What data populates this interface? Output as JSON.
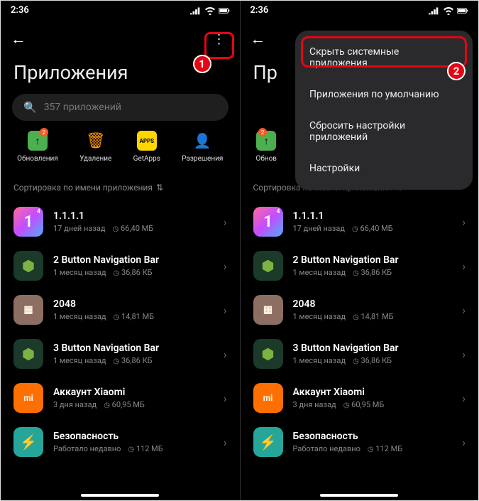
{
  "status": {
    "time": "2:36"
  },
  "header": {
    "title": "Приложения",
    "title_cut": "Пр"
  },
  "search": {
    "placeholder": "357 приложений"
  },
  "actions": {
    "updates": {
      "label": "Обновления",
      "badge": "2"
    },
    "delete": {
      "label": "Удаление"
    },
    "getapps": {
      "label": "GetApps",
      "icon_text": "APPS"
    },
    "permissions": {
      "label": "Разрешения"
    },
    "updates_cut": {
      "label": "Обнов"
    }
  },
  "sort": {
    "label": "Сортировка по имени приложения"
  },
  "menu": {
    "hide_system": "Скрыть системные приложения",
    "default_apps": "Приложения по умолчанию",
    "reset_prefs": "Сбросить настройки приложений",
    "settings": "Настройки"
  },
  "callouts": {
    "one": "1",
    "two": "2"
  },
  "apps": [
    {
      "name": "1.1.1.1",
      "time": "17 дней назад",
      "size": "66,40 МБ",
      "icon": "1111",
      "sup": "4"
    },
    {
      "name": "2 Button Navigation Bar",
      "time": "1 месяц назад",
      "size": "36,86 КБ",
      "icon": "droid"
    },
    {
      "name": "2048",
      "time": "1 месяц назад",
      "size": "14,81 МБ",
      "icon": "2048"
    },
    {
      "name": "3 Button Navigation Bar",
      "time": "1 месяц назад",
      "size": "36,86 КБ",
      "icon": "droid"
    },
    {
      "name": "Аккаунт Xiaomi",
      "time": "3 дня назад",
      "size": "60,95 МБ",
      "icon": "mi"
    },
    {
      "name": "Безопасность",
      "time": "Работало недавно",
      "size": "112 МБ",
      "icon": "sec"
    }
  ]
}
